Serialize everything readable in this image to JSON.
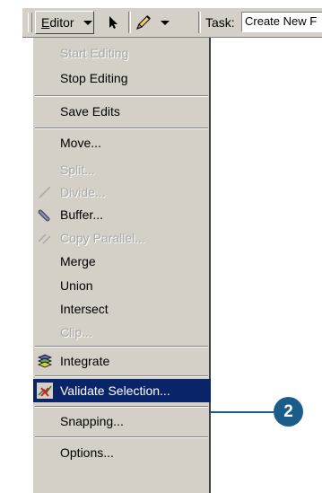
{
  "toolbar": {
    "editor_prefix": "E",
    "editor_rest": "ditor",
    "task_label": "Task:",
    "task_value": "Create New F"
  },
  "menu": {
    "start_editing": "Start Editing",
    "stop_editing": "Stop Editing",
    "save_edits": "Save Edits",
    "move": "Move...",
    "split": "Split...",
    "divide": "Divide...",
    "buffer": "Buffer...",
    "copy_parallel": "Copy Parallel...",
    "merge": "Merge",
    "union": "Union",
    "intersect": "Intersect",
    "clip": "Clip...",
    "integrate": "Integrate",
    "validate_selection": "Validate Selection...",
    "snapping": "Snapping...",
    "options": "Options..."
  },
  "callout": {
    "number": "2"
  },
  "colors": {
    "menu_bg": "#d4d0c8",
    "highlight": "#0a246a",
    "callout": "#1a5c8a"
  }
}
